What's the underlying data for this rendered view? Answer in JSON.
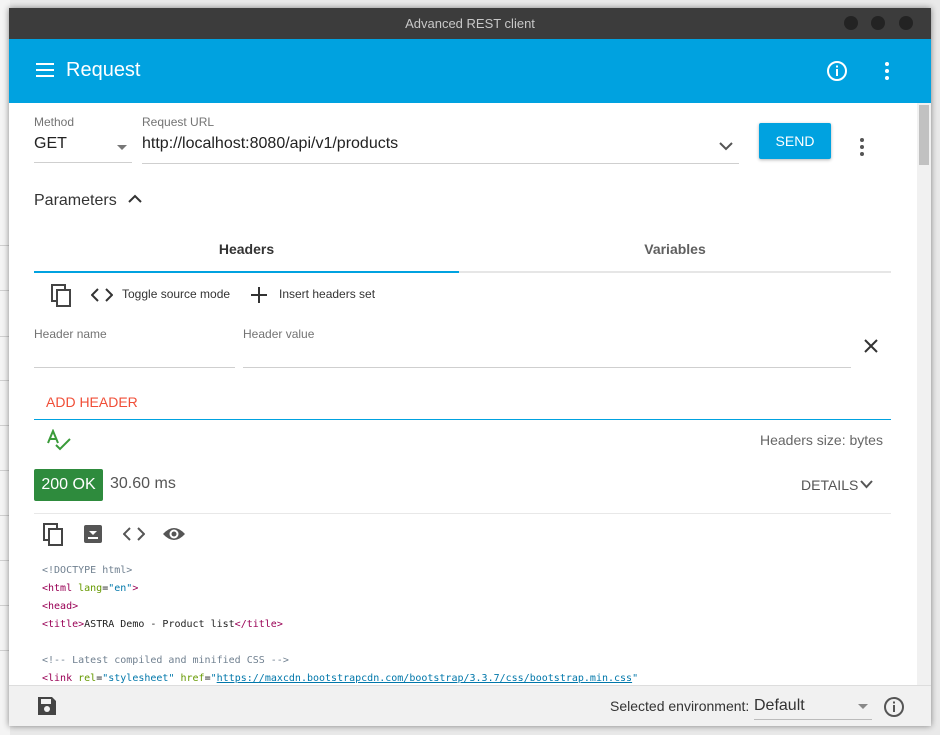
{
  "window": {
    "title": "Advanced REST client"
  },
  "appbar": {
    "title": "Request",
    "icons": [
      "menu-icon",
      "info-icon",
      "more-vert-icon"
    ],
    "color": "#00a2e0"
  },
  "request": {
    "method_label": "Method",
    "method_value": "GET",
    "url_label": "Request URL",
    "url_value": "http://localhost:8080/api/v1/products",
    "send_label": "SEND"
  },
  "parameters": {
    "title": "Parameters",
    "tabs": [
      {
        "label": "Headers",
        "active": true
      },
      {
        "label": "Variables",
        "active": false
      }
    ],
    "toolbar": {
      "toggle_label": "Toggle source mode",
      "insert_label": "Insert headers set"
    },
    "header_row": {
      "name_label": "Header name",
      "value_label": "Header value"
    },
    "add_header_label": "ADD HEADER",
    "headers_size": "Headers size: bytes"
  },
  "response": {
    "status": "200 OK",
    "status_color": "#2e8b3d",
    "time": "30.60 ms",
    "details_label": "DETAILS",
    "body": [
      [
        [
          "c-com",
          "<!DOCTYPE html>"
        ]
      ],
      [
        [
          "c-tag",
          "<html "
        ],
        [
          "c-attr",
          "lang"
        ],
        [
          "",
          "="
        ],
        [
          "c-val",
          "\"en\""
        ],
        [
          "c-tag",
          ">"
        ]
      ],
      [
        [
          "c-tag",
          "<head>"
        ]
      ],
      [
        [
          "c-tag",
          "<title>"
        ],
        [
          "",
          "ASTRA Demo - Product list"
        ],
        [
          "c-tag",
          "</title>"
        ]
      ],
      [],
      [
        [
          "c-com",
          "<!-- Latest compiled and minified CSS -->"
        ]
      ],
      [
        [
          "c-tag",
          "<link "
        ],
        [
          "c-attr",
          "rel"
        ],
        [
          "",
          "="
        ],
        [
          "c-val",
          "\"stylesheet\""
        ],
        [
          "",
          " "
        ],
        [
          "c-attr",
          "href"
        ],
        [
          "",
          "="
        ],
        [
          "c-val",
          "\""
        ],
        [
          "c-link",
          "https://maxcdn.bootstrapcdn.com/bootstrap/3.3.7/css/bootstrap.min.css"
        ],
        [
          "c-val",
          "\""
        ]
      ]
    ]
  },
  "bottom": {
    "env_label": "Selected environment:",
    "env_value": "Default"
  }
}
